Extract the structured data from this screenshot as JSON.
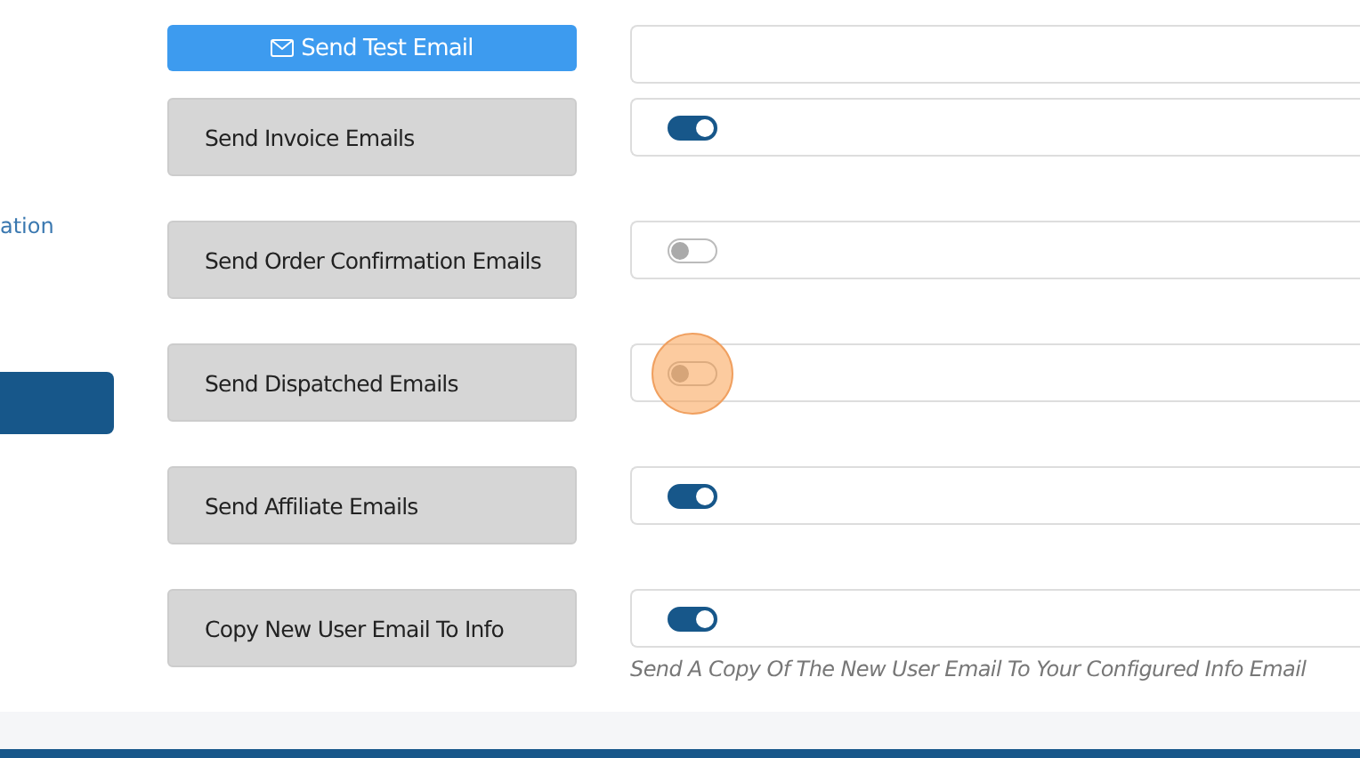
{
  "sidebar": {
    "link": "ation",
    "button": {
      "kind": "button"
    }
  },
  "test_email": {
    "button": "Send Test Email"
  },
  "settings": [
    {
      "label": "Send Invoice Emails",
      "on": true,
      "touched": false
    },
    {
      "label": "Send Order Confirmation Emails",
      "on": false,
      "touched": false
    },
    {
      "label": "Send Dispatched Emails",
      "on": false,
      "touched": true
    },
    {
      "label": "Send Affiliate Emails",
      "on": true,
      "touched": false
    },
    {
      "label": "Copy New User Email To Info",
      "on": true,
      "touched": false,
      "hint": "Send A Copy Of The New User Email To Your Configured Info Email"
    }
  ]
}
